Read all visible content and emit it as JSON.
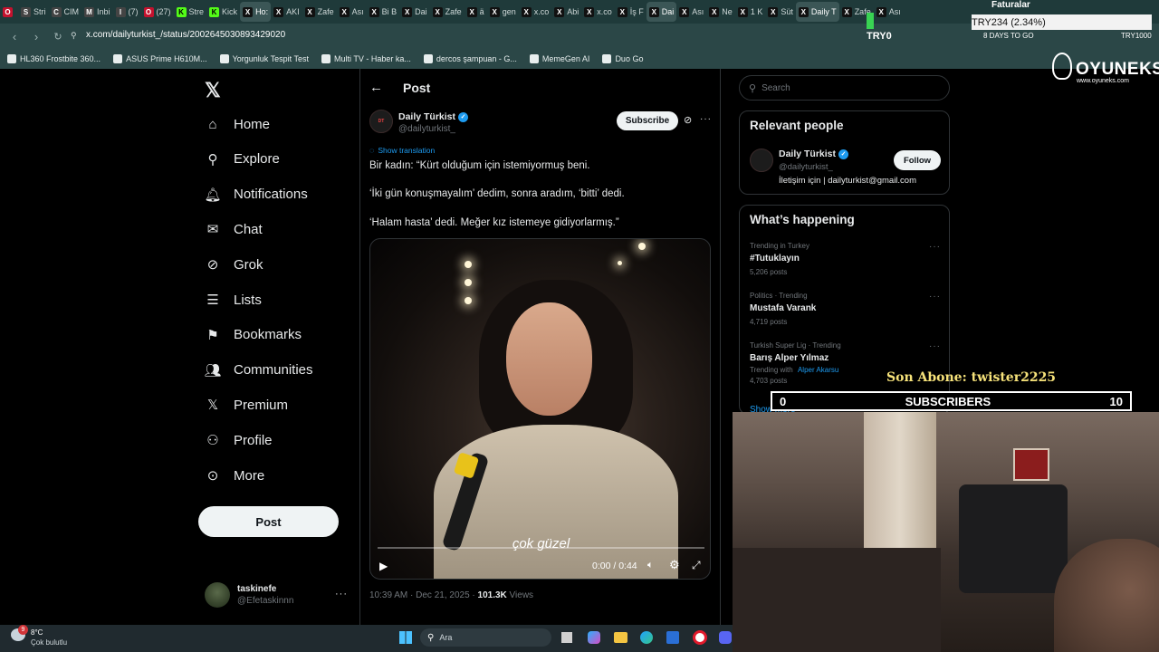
{
  "browser": {
    "tabs": [
      {
        "icon": "O",
        "label": ""
      },
      {
        "icon": "S",
        "label": "Stri"
      },
      {
        "icon": "C",
        "label": "CIM"
      },
      {
        "icon": "M",
        "label": "Inbi"
      },
      {
        "icon": "I",
        "label": "(7)"
      },
      {
        "icon": "O",
        "label": "(27)"
      },
      {
        "icon": "K",
        "label": "Stre"
      },
      {
        "icon": "K",
        "label": "Kick"
      },
      {
        "icon": "X",
        "label": "Ho:"
      },
      {
        "icon": "X",
        "label": "AKI"
      },
      {
        "icon": "X",
        "label": "Zafe"
      },
      {
        "icon": "X",
        "label": "Ası"
      },
      {
        "icon": "X",
        "label": "Bi B"
      },
      {
        "icon": "X",
        "label": "Dai"
      },
      {
        "icon": "X",
        "label": "Zafe"
      },
      {
        "icon": "X",
        "label": "ä"
      },
      {
        "icon": "X",
        "label": "gen"
      },
      {
        "icon": "X",
        "label": "x.co"
      },
      {
        "icon": "X",
        "label": "Abi"
      },
      {
        "icon": "X",
        "label": "x.co"
      },
      {
        "icon": "X",
        "label": "İş F"
      },
      {
        "icon": "X",
        "label": "Dai"
      },
      {
        "icon": "X",
        "label": "Ası"
      },
      {
        "icon": "X",
        "label": "Ne"
      },
      {
        "icon": "X",
        "label": "1 K"
      },
      {
        "icon": "X",
        "label": "Süt"
      },
      {
        "icon": "X",
        "label": "Daily T"
      },
      {
        "icon": "X",
        "label": "Zafe"
      },
      {
        "icon": "X",
        "label": "Ası"
      }
    ],
    "url": "x.com/dailyturkist_/status/2002645030893429020",
    "bookmarks": [
      "HL360 Frostbite 360...",
      "ASUS Prime H610M...",
      "Yorgunluk Tespit Test",
      "Multi TV - Haber ka...",
      "dercos şampuan - G...",
      "MemeGen AI",
      "Duo Go"
    ]
  },
  "nav": {
    "items": [
      {
        "label": "Home",
        "icon": "home-icon"
      },
      {
        "label": "Explore",
        "icon": "search-icon"
      },
      {
        "label": "Notifications",
        "icon": "bell-icon"
      },
      {
        "label": "Chat",
        "icon": "envelope-icon"
      },
      {
        "label": "Grok",
        "icon": "grok-icon"
      },
      {
        "label": "Lists",
        "icon": "list-icon"
      },
      {
        "label": "Bookmarks",
        "icon": "bookmark-icon"
      },
      {
        "label": "Communities",
        "icon": "people-icon"
      },
      {
        "label": "Premium",
        "icon": "x-icon"
      },
      {
        "label": "Profile",
        "icon": "person-icon"
      },
      {
        "label": "More",
        "icon": "more-circle-icon"
      }
    ],
    "post_button": "Post",
    "account": {
      "name": "taskinefe",
      "handle": "@Efetaskinnn"
    }
  },
  "post": {
    "header": "Post",
    "author_name": "Daily Türkist",
    "author_handle": "@dailyturkist_",
    "subscribe_label": "Subscribe",
    "show_translation": "Show translation",
    "lines": [
      "Bir kadın: “Kürt olduğum için istemiyormuş beni.",
      "‘İki gün konuşmayalım’ dedim, sonra aradım, ‘bitti’ dedi.",
      "‘Halam hasta’ dedi. Meğer kız istemeye gidiyorlarmış.”"
    ],
    "video": {
      "caption": "çok güzel",
      "time": "0:00 / 0:44",
      "progress": 0
    },
    "timestamp": "10:39 AM · Dec 21, 2025",
    "views_count": "101.3K",
    "views_label": "Views"
  },
  "sidebar": {
    "search_placeholder": "Search",
    "relevant": {
      "title": "Relevant people",
      "name": "Daily Türkist",
      "handle": "@dailyturkist_",
      "bio": "İletişim için | dailyturkist@gmail.com",
      "follow_label": "Follow"
    },
    "happening": {
      "title": "What’s happening",
      "trends": [
        {
          "context": "Trending in Turkey",
          "title": "#Tutuklayın",
          "count": "5,206 posts"
        },
        {
          "context": "Politics · Trending",
          "title": "Mustafa Varank",
          "count": "4,719 posts"
        },
        {
          "context": "Turkish Super Lig · Trending",
          "title": "Barış Alper Yılmaz",
          "trending_with": "Trending with",
          "trending_with_name": "Alper Akarsu",
          "count": "4,703 posts"
        }
      ],
      "show_more": "Show more"
    }
  },
  "stream": {
    "ticker": "TRY234 (2.34%)",
    "ticker_label": "Faturalar",
    "try_label": "TRY0",
    "days_to_go": "8 DAYS TO GO",
    "try_right": "TRY1000",
    "son_abone": "Son Abone: twister2225",
    "subs_left": "0",
    "subs_label": "SUBSCRIBERS",
    "subs_right": "10",
    "brand": "OYUNEKS",
    "brand_url": "www.oyuneks.com"
  },
  "taskbar": {
    "weather_temp": "8°C",
    "weather_desc": "Çok bulutlu",
    "weather_badge": "9",
    "search_label": "Ara"
  },
  "colors": {
    "verified": "#1d9bf0",
    "link": "#1d9bf0",
    "ticker_green": "#39d353"
  }
}
